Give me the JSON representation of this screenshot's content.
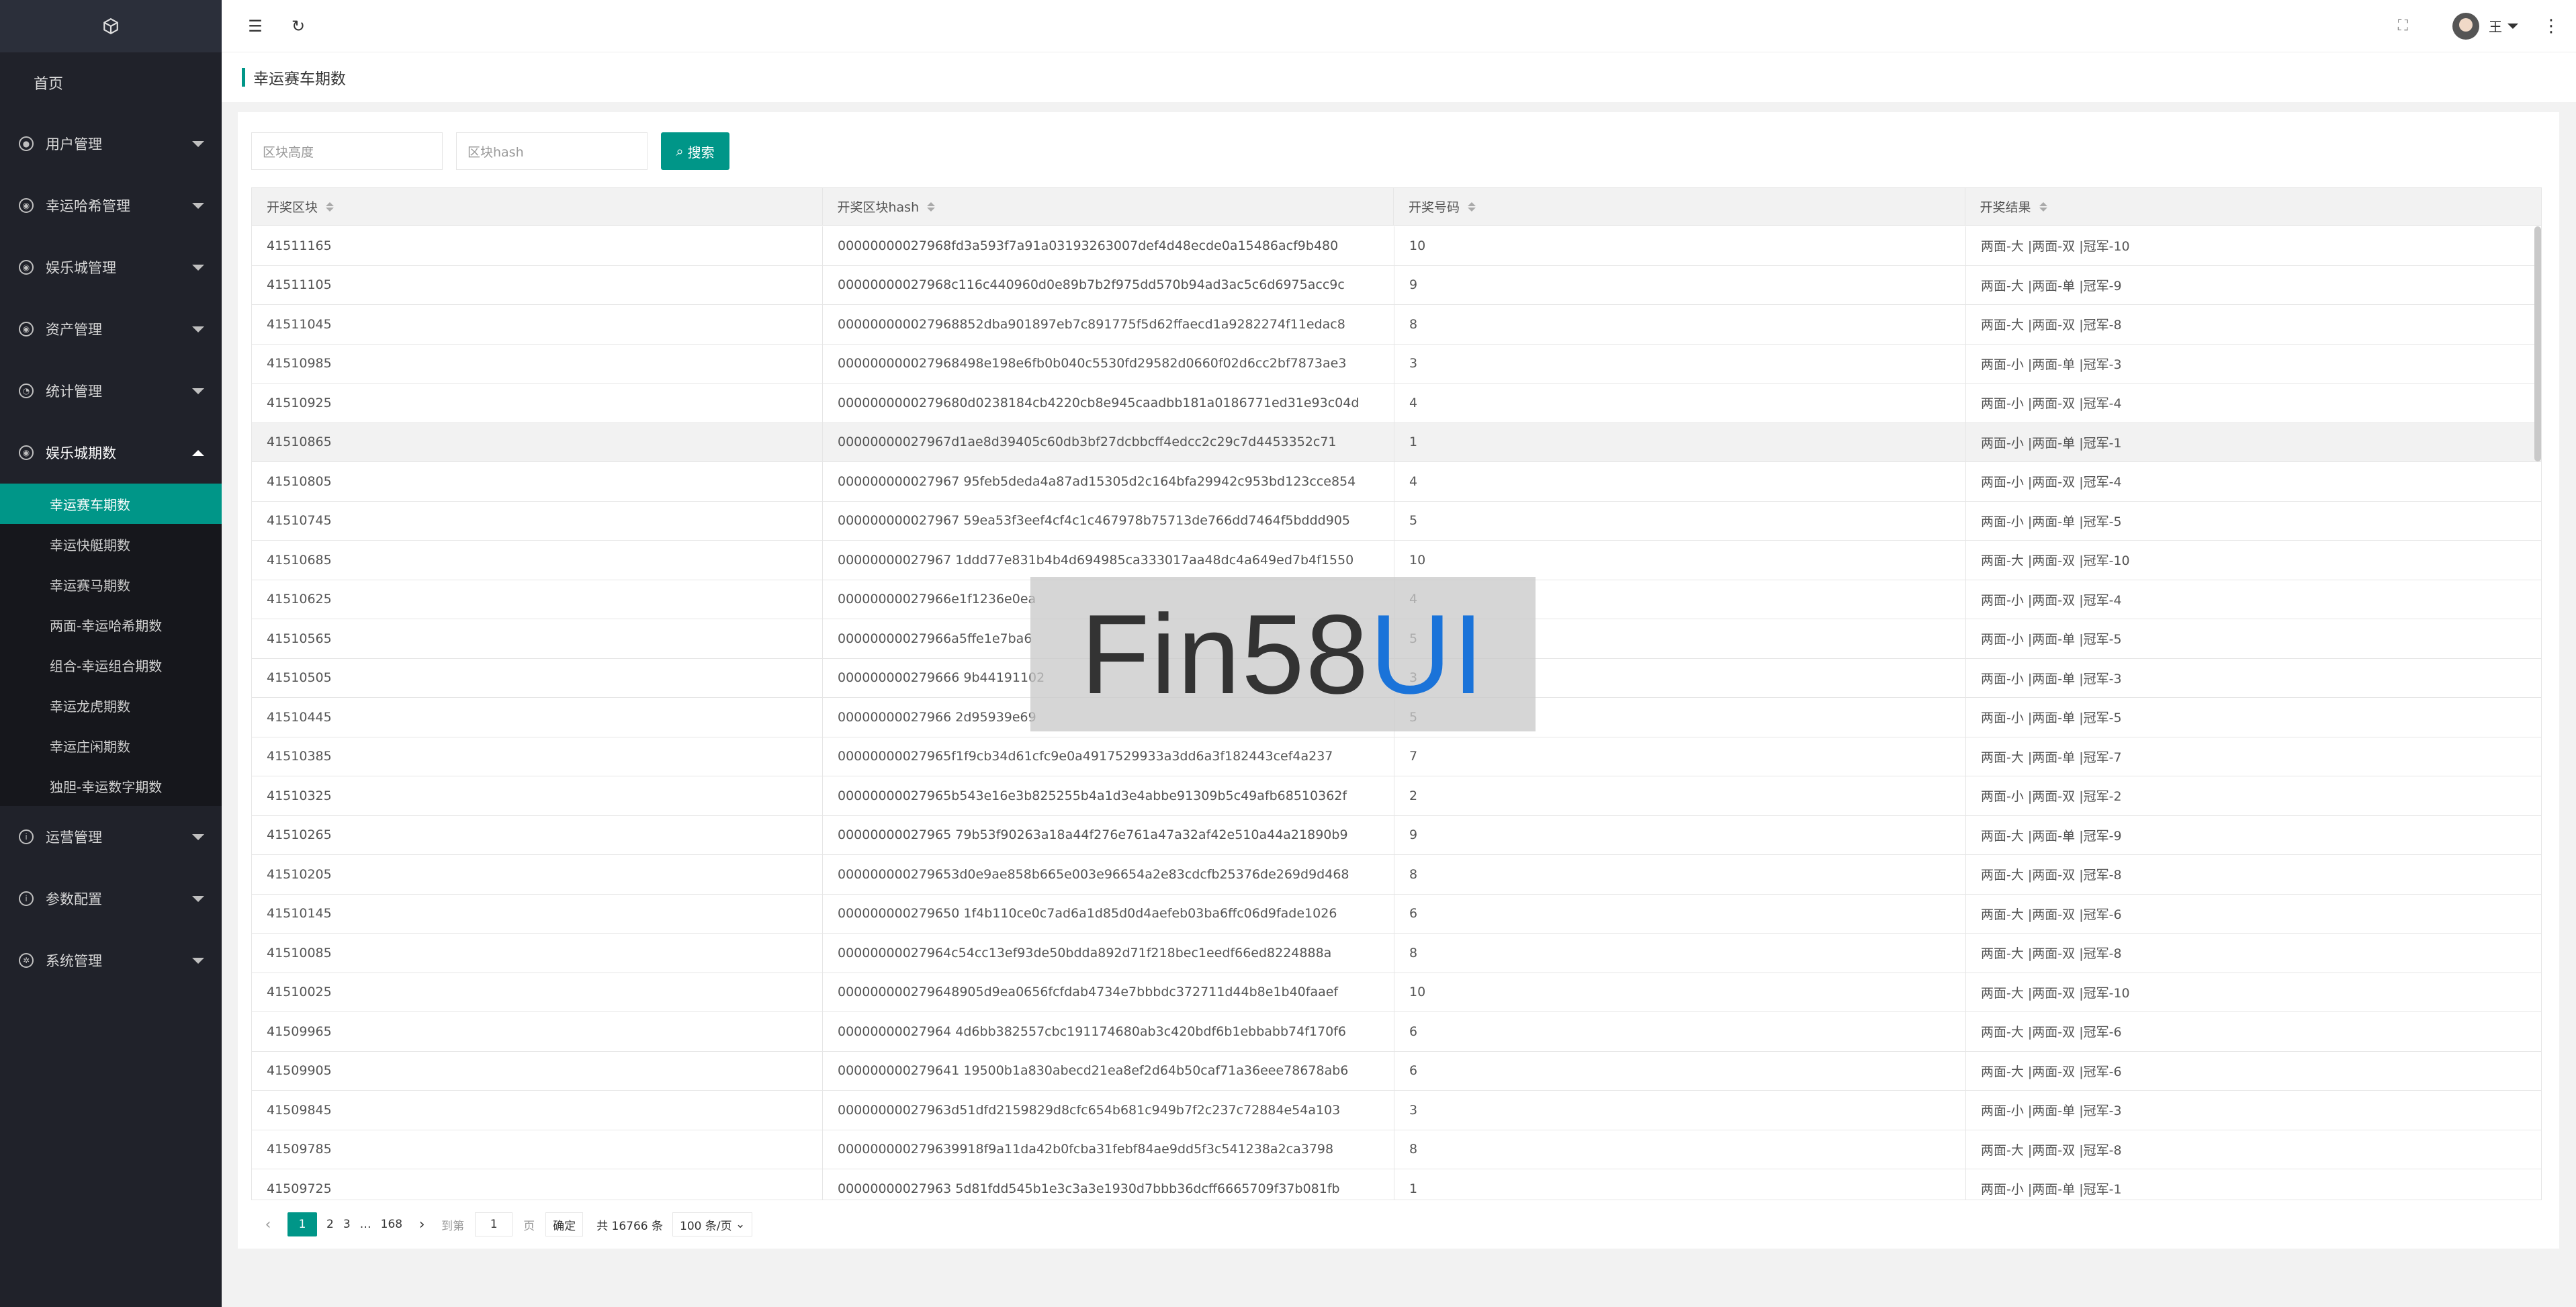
{
  "sidebar": {
    "home": "首页",
    "groups": [
      {
        "label": "用户管理",
        "icon": "user-icon"
      },
      {
        "label": "幸运哈希管理",
        "icon": "hash-icon"
      },
      {
        "label": "娱乐城管理",
        "icon": "casino-icon"
      },
      {
        "label": "资产管理",
        "icon": "asset-icon"
      },
      {
        "label": "统计管理",
        "icon": "stats-icon"
      },
      {
        "label": "娱乐城期数",
        "icon": "period-icon"
      }
    ],
    "sub_items": [
      "幸运赛车期数",
      "幸运快艇期数",
      "幸运赛马期数",
      "两面-幸运哈希期数",
      "组合-幸运组合期数",
      "幸运龙虎期数",
      "幸运庄闲期数",
      "独胆-幸运数字期数"
    ],
    "groups2": [
      {
        "label": "运营管理",
        "icon": "info-icon"
      },
      {
        "label": "参数配置",
        "icon": "info-icon"
      },
      {
        "label": "系统管理",
        "icon": "gear-icon"
      }
    ]
  },
  "topbar": {
    "username": "王"
  },
  "breadcrumb": {
    "title": "幸运赛车期数"
  },
  "search": {
    "height_placeholder": "区块高度",
    "hash_placeholder": "区块hash",
    "button_label": "搜索"
  },
  "table": {
    "headers": [
      "开奖区块",
      "开奖区块hash",
      "开奖号码",
      "开奖结果"
    ],
    "rows": [
      [
        "41511165",
        "00000000027968fd3a593f7a91a03193263007def4d48ecde0a15486acf9b480",
        "10",
        "两面-大 |两面-双 |冠军-10"
      ],
      [
        "41511105",
        "00000000027968c116c440960d0e89b7b2f975dd570b94ad3ac5c6d6975acc9c",
        "9",
        "两面-大 |两面-单 |冠军-9"
      ],
      [
        "41511045",
        "000000000027968852dba901897eb7c891775f5d62ffaecd1a9282274f11edac8",
        "8",
        "两面-大 |两面-双 |冠军-8"
      ],
      [
        "41510985",
        "000000000027968498e198e6fb0b040c5530fd29582d0660f02d6cc2bf7873ae3",
        "3",
        "两面-小 |两面-单 |冠军-3"
      ],
      [
        "41510925",
        "0000000000279680d0238184cb4220cb8e945caadbb181a0186771ed31e93c04d",
        "4",
        "两面-小 |两面-双 |冠军-4"
      ],
      [
        "41510865",
        "00000000027967d1ae8d39405c60db3bf27dcbbcff4edcc2c29c7d4453352c71",
        "1",
        "两面-小 |两面-单 |冠军-1"
      ],
      [
        "41510805",
        "000000000027967 95feb5deda4a87ad15305d2c164bfa29942c953bd123cce854",
        "4",
        "两面-小 |两面-双 |冠军-4"
      ],
      [
        "41510745",
        "000000000027967 59ea53f3eef4cf4c1c467978b75713de766dd7464f5bddd905",
        "5",
        "两面-小 |两面-单 |冠军-5"
      ],
      [
        "41510685",
        "00000000027967 1ddd77e831b4b4d694985ca333017aa48dc4a649ed7b4f1550",
        "10",
        "两面-大 |两面-双 |冠军-10"
      ],
      [
        "41510625",
        "00000000027966e1f1236e0ea",
        "4",
        "两面-小 |两面-双 |冠军-4"
      ],
      [
        "41510565",
        "00000000027966a5ffe1e7ba6",
        "5",
        "两面-小 |两面-单 |冠军-5"
      ],
      [
        "41510505",
        "000000000279666 9b44191102",
        "3",
        "两面-小 |两面-单 |冠军-3"
      ],
      [
        "41510445",
        "00000000027966 2d95939e69",
        "5",
        "两面-小 |两面-单 |冠军-5"
      ],
      [
        "41510385",
        "00000000027965f1f9cb34d61cfc9e0a4917529933a3dd6a3f182443cef4a237",
        "7",
        "两面-大 |两面-单 |冠军-7"
      ],
      [
        "41510325",
        "00000000027965b543e16e3b825255b4a1d3e4abbe91309b5c49afb68510362f",
        "2",
        "两面-小 |两面-双 |冠军-2"
      ],
      [
        "41510265",
        "00000000027965 79b53f90263a18a44f276e761a47a32af42e510a44a21890b9",
        "9",
        "两面-大 |两面-单 |冠军-9"
      ],
      [
        "41510205",
        "000000000279653d0e9ae858b665e003e96654a2e83cdcfb25376de269d9d468",
        "8",
        "两面-大 |两面-双 |冠军-8"
      ],
      [
        "41510145",
        "000000000279650 1f4b110ce0c7ad6a1d85d0d4aefeb03ba6ffc06d9fade1026",
        "6",
        "两面-大 |两面-双 |冠军-6"
      ],
      [
        "41510085",
        "00000000027964c54cc13ef93de50bdda892d71f218bec1eedf66ed8224888a",
        "8",
        "两面-大 |两面-双 |冠军-8"
      ],
      [
        "41510025",
        "000000000279648905d9ea0656fcfdab4734e7bbbdc372711d44b8e1b40faaef",
        "10",
        "两面-大 |两面-双 |冠军-10"
      ],
      [
        "41509965",
        "00000000027964 4d6bb382557cbc191174680ab3c420bdf6b1ebbabb74f170f6",
        "6",
        "两面-大 |两面-双 |冠军-6"
      ],
      [
        "41509905",
        "000000000279641 19500b1a830abecd21ea8ef2d64b50caf71a36eee78678ab6",
        "6",
        "两面-大 |两面-双 |冠军-6"
      ],
      [
        "41509845",
        "00000000027963d51dfd2159829d8cfc654b681c949b7f2c237c72884e54a103",
        "3",
        "两面-小 |两面-单 |冠军-3"
      ],
      [
        "41509785",
        "000000000279639918f9a11da42b0fcba31febf84ae9dd5f3c541238a2ca3798",
        "8",
        "两面-大 |两面-双 |冠军-8"
      ],
      [
        "41509725",
        "00000000027963 5d81fdd545b1e3c3a3e1930d7bbb36dcff6665709f37b081fb",
        "1",
        "两面-小 |两面-单 |冠军-1"
      ]
    ]
  },
  "pager": {
    "prev": "‹",
    "pages": [
      "1",
      "2",
      "3"
    ],
    "ellipsis": "…",
    "last": "168",
    "next": "›",
    "goto_label": "到第",
    "goto_value": "1",
    "page_unit": "页",
    "confirm": "确定",
    "total": "共 16766 条",
    "page_size": "100 条/页"
  },
  "watermark": {
    "part1": "Fin58",
    "part2": "UI"
  },
  "colors": {
    "accent": "#009688",
    "sidebar_bg": "#20222a"
  }
}
